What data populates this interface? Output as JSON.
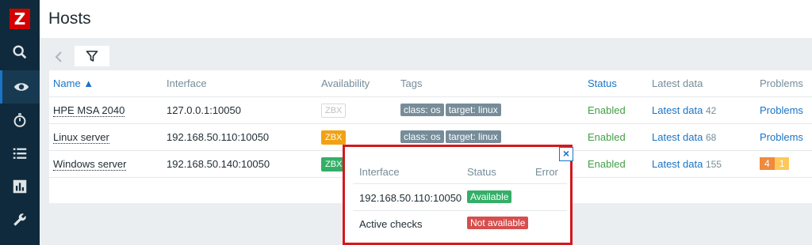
{
  "sidebar": {
    "logo": "Z",
    "items": [
      {
        "icon": "search-icon"
      },
      {
        "icon": "eye-icon",
        "active": true
      },
      {
        "icon": "stopwatch-icon"
      },
      {
        "icon": "list-icon"
      },
      {
        "icon": "bar-chart-icon"
      },
      {
        "icon": "wrench-icon"
      }
    ]
  },
  "header": {
    "title": "Hosts"
  },
  "filter": {
    "back_icon": "chevron-left-icon",
    "tab_icon": "filter-icon"
  },
  "table": {
    "columns": {
      "name": "Name ▲",
      "interface": "Interface",
      "availability": "Availability",
      "tags": "Tags",
      "status": "Status",
      "latest_data": "Latest data",
      "problems": "Problems"
    },
    "rows": [
      {
        "name": "HPE MSA 2040",
        "interface": "127.0.0.1:10050",
        "availability": "ZBX",
        "tags": [
          "class: os",
          "target: linux"
        ],
        "status": "Enabled",
        "latest_data": "Latest data",
        "latest_count": "42",
        "problems": "Problems"
      },
      {
        "name": "Linux server",
        "interface": "192.168.50.110:10050",
        "availability": "ZBX",
        "tags": [
          "class: os",
          "target: linux"
        ],
        "status": "Enabled",
        "latest_data": "Latest data",
        "latest_count": "68",
        "problems": "Problems"
      },
      {
        "name": "Windows server",
        "interface": "192.168.50.140:10050",
        "availability": "ZBX",
        "status": "Enabled",
        "latest_data": "Latest data",
        "latest_count": "155",
        "problem_counts": [
          "4",
          "1"
        ]
      }
    ]
  },
  "popup": {
    "close": "×",
    "headers": {
      "interface": "Interface",
      "status": "Status",
      "error": "Error"
    },
    "rows": [
      {
        "interface": "192.168.50.110:10050",
        "status": "Available"
      },
      {
        "interface": "Active checks",
        "status": "Not available"
      }
    ]
  },
  "colors": {
    "sidebar_bg": "#0f2a3c",
    "link": "#1a74c6",
    "enabled": "#429e47",
    "zbx_orange": "#f1a214",
    "zbx_green": "#34af67",
    "problem_high": "#f08a3c",
    "problem_avg": "#ffc859",
    "popup_border": "#d3181e"
  }
}
